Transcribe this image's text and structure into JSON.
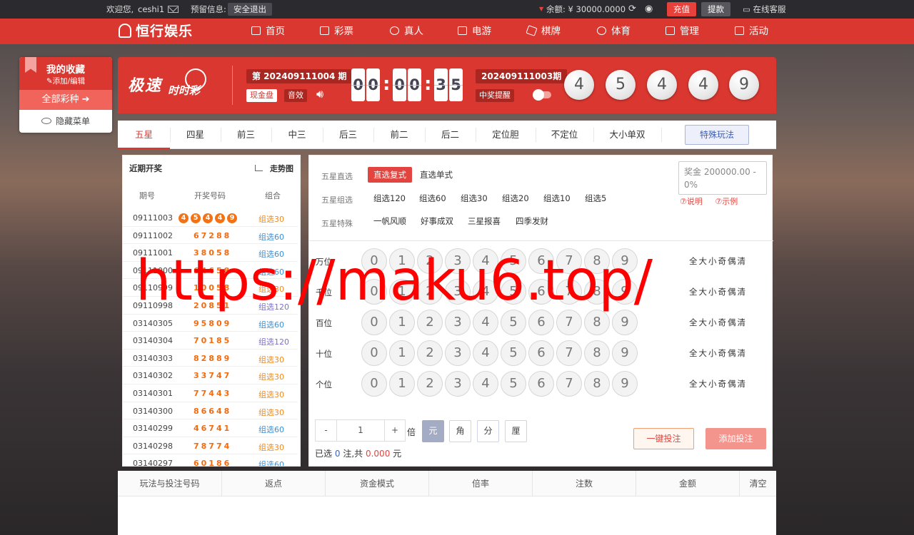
{
  "topbar": {
    "welcome": "欢迎您,",
    "username": "ceshi1",
    "reserve_label": "预留信息:",
    "logout": "安全退出",
    "balance_label": "余额: ¥ 30000.0000",
    "recharge": "充值",
    "withdraw": "提款",
    "service": "在线客服"
  },
  "brand": "恒行娱乐",
  "nav": [
    "首页",
    "彩票",
    "真人",
    "电游",
    "棋牌",
    "体育",
    "管理",
    "活动"
  ],
  "favorites": {
    "title": "我的收藏",
    "edit": "添加/编辑",
    "all": "全部彩种",
    "arrow": "➔",
    "hide": "隐藏菜单"
  },
  "game": {
    "name_main": "极速",
    "name_sub": "时时彩",
    "current_issue": "第 202409111004 期",
    "cash_mode": "现金盘",
    "sound": "音效",
    "countdown": [
      "0",
      "0",
      "0",
      "0",
      "3",
      "5"
    ],
    "last_issue": "202409111003期",
    "win_remind": "中奖提醒",
    "last_numbers": [
      "4",
      "5",
      "4",
      "4",
      "9"
    ]
  },
  "tabs": [
    "五星",
    "四星",
    "前三",
    "中三",
    "后三",
    "前二",
    "后二",
    "定位胆",
    "不定位",
    "大小单双"
  ],
  "special_play": "特殊玩法",
  "recent": {
    "title": "近期开奖",
    "trend": "走势图",
    "headers": [
      "期号",
      "开奖号码",
      "组合"
    ],
    "first": {
      "period": "09111003",
      "balls": [
        "4",
        "5",
        "4",
        "4",
        "9"
      ],
      "group": "组选30"
    },
    "rows": [
      {
        "period": "09111002",
        "numbers": "67288",
        "group": "组选60"
      },
      {
        "period": "09111001",
        "numbers": "38058",
        "group": "组选60"
      },
      {
        "period": "09111000",
        "numbers": "64658",
        "group": "组选60"
      },
      {
        "period": "09110999",
        "numbers": "10058",
        "group": "组选30"
      },
      {
        "period": "09110998",
        "numbers": "20851",
        "group": "组选120"
      },
      {
        "period": "03140305",
        "numbers": "95809",
        "group": "组选60"
      },
      {
        "period": "03140304",
        "numbers": "70185",
        "group": "组选120"
      },
      {
        "period": "03140303",
        "numbers": "82889",
        "group": "组选30"
      },
      {
        "period": "03140302",
        "numbers": "33747",
        "group": "组选30"
      },
      {
        "period": "03140301",
        "numbers": "77443",
        "group": "组选30"
      },
      {
        "period": "03140300",
        "numbers": "86648",
        "group": "组选30"
      },
      {
        "period": "03140299",
        "numbers": "46741",
        "group": "组选60"
      },
      {
        "period": "03140298",
        "numbers": "78774",
        "group": "组选30"
      },
      {
        "period": "03140297",
        "numbers": "60186",
        "group": "组选60"
      }
    ]
  },
  "bet": {
    "label_direct": "五星直选",
    "opt_direct": [
      "直选复式",
      "直选单式"
    ],
    "label_group": "五星组选",
    "opt_group": [
      "组选120",
      "组选60",
      "组选30",
      "组选20",
      "组选10",
      "组选5"
    ],
    "label_special": "五星特殊",
    "opt_special": [
      "一帆风顺",
      "好事成双",
      "三星报喜",
      "四季发财"
    ],
    "prize": "奖金 200000.00 - 0%",
    "explain": "⑦说明",
    "example": "⑦示例",
    "positions": [
      "万位",
      "千位",
      "百位",
      "十位",
      "个位"
    ],
    "digits": [
      "0",
      "1",
      "2",
      "3",
      "4",
      "5",
      "6",
      "7",
      "8",
      "9"
    ],
    "quick": [
      "全",
      "大",
      "小",
      "奇",
      "偶",
      "清"
    ],
    "minus": "-",
    "multiple": "1",
    "plus": "+",
    "times": "倍",
    "units": [
      "元",
      "角",
      "分",
      "厘"
    ],
    "selected_pre": "已选",
    "selected_count": "0",
    "selected_mid": "注,共",
    "amount": "0.000",
    "currency": "元",
    "quick_bet": "一键投注",
    "add_bet": "添加投注"
  },
  "table_headers": [
    "玩法与投注号码",
    "返点",
    "资金模式",
    "倍率",
    "注数",
    "金额",
    "清空"
  ],
  "watermark": "https://maku6.top/",
  "colors": {
    "brand_red": "#d9372f",
    "orange_ball": "#f47216",
    "link_blue": "#4063b8"
  }
}
